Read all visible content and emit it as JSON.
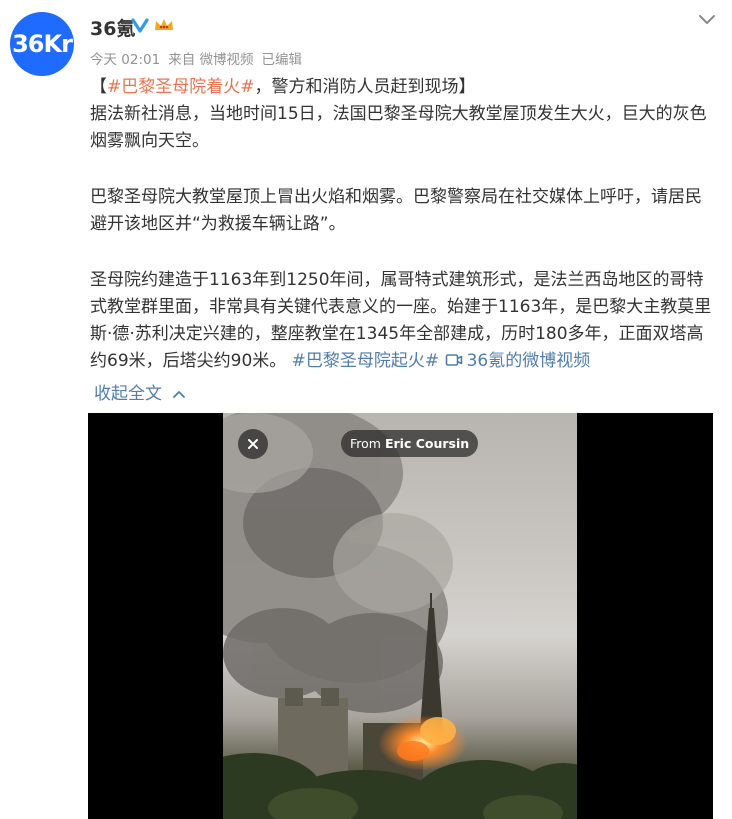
{
  "post": {
    "avatar_text": "36Kr",
    "username": "36氪",
    "meta": {
      "time": "今天 02:01",
      "source": "来自 微博视频",
      "edited": "已编辑"
    },
    "content": {
      "p1_open": "【",
      "p1_hashtag": "#巴黎圣母院着火#",
      "p1_rest": "，警方和消防人员赶到现场】",
      "p1_body": "据法新社消息，当地时间15日，法国巴黎圣母院大教堂屋顶发生大火，巨大的灰色烟雾飘向天空。",
      "p2": "巴黎圣母院大教堂屋顶上冒出火焰和烟雾。巴黎警察局在社交媒体上呼吁，请居民避开该地区并“为救援车辆让路”。",
      "p3": "圣母院约建造于1163年到1250年间，属哥特式建筑形式，是法兰西岛地区的哥特式教堂群里面，非常具有关键代表意义的一座。始建于1163年，是巴黎大主教莫里斯·德·苏利决定兴建的，整座教堂在1345年全部建成，历时180多年，正面双塔高约69米，后塔尖约90米。",
      "p3_hashtag": "#巴黎圣母院起火#",
      "p3_video_link": "36氪的微博视频"
    },
    "collapse_label": "收起全文",
    "video": {
      "from_prefix": "From",
      "from_name": "Eric Coursin"
    }
  },
  "colors": {
    "link_orange": "#eb7350",
    "link_blue": "#507daf",
    "avatar_blue": "#1f6bff"
  },
  "icons": [
    "verified-icon",
    "vip-crown-icon",
    "chevron-down-icon",
    "video-icon",
    "chevron-up-icon",
    "close-icon"
  ]
}
